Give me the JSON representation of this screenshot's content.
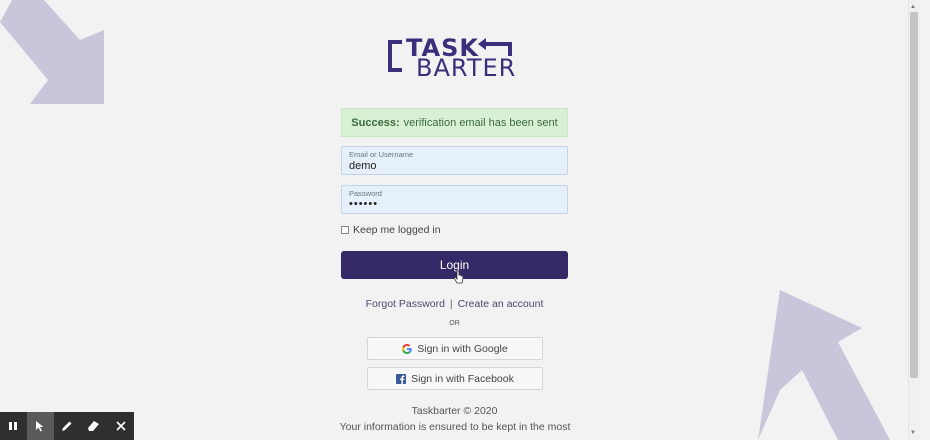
{
  "logo": {
    "line1": "TASK",
    "line2": "BARTER",
    "color": "#3a2f7a"
  },
  "alert": {
    "strong": "Success:",
    "message": "verification email has been sent"
  },
  "email": {
    "label": "Email or Username",
    "value": "demo"
  },
  "password": {
    "label": "Password",
    "value": "••••••"
  },
  "remember": {
    "label": "Keep me logged in",
    "checked": false
  },
  "login_button": {
    "label": "Login",
    "color": "#352866"
  },
  "links": {
    "forgot": "Forgot Password",
    "separator": "|",
    "create": "Create an account"
  },
  "or_label": "OR",
  "social": {
    "google": "Sign in with Google",
    "facebook": "Sign in with Facebook"
  },
  "footer": {
    "copyright": "Taskbarter © 2020",
    "info": "Your information is ensured to be kept in the most"
  },
  "toolbar": {
    "icons": [
      "pause-icon",
      "pointer-icon",
      "pen-icon",
      "eraser-icon",
      "close-icon"
    ],
    "active": "pointer-icon"
  },
  "colors": {
    "background": "#f2f2f2",
    "decor_arrow": "#c9c6dc",
    "alert_bg": "#d8f0d4"
  }
}
